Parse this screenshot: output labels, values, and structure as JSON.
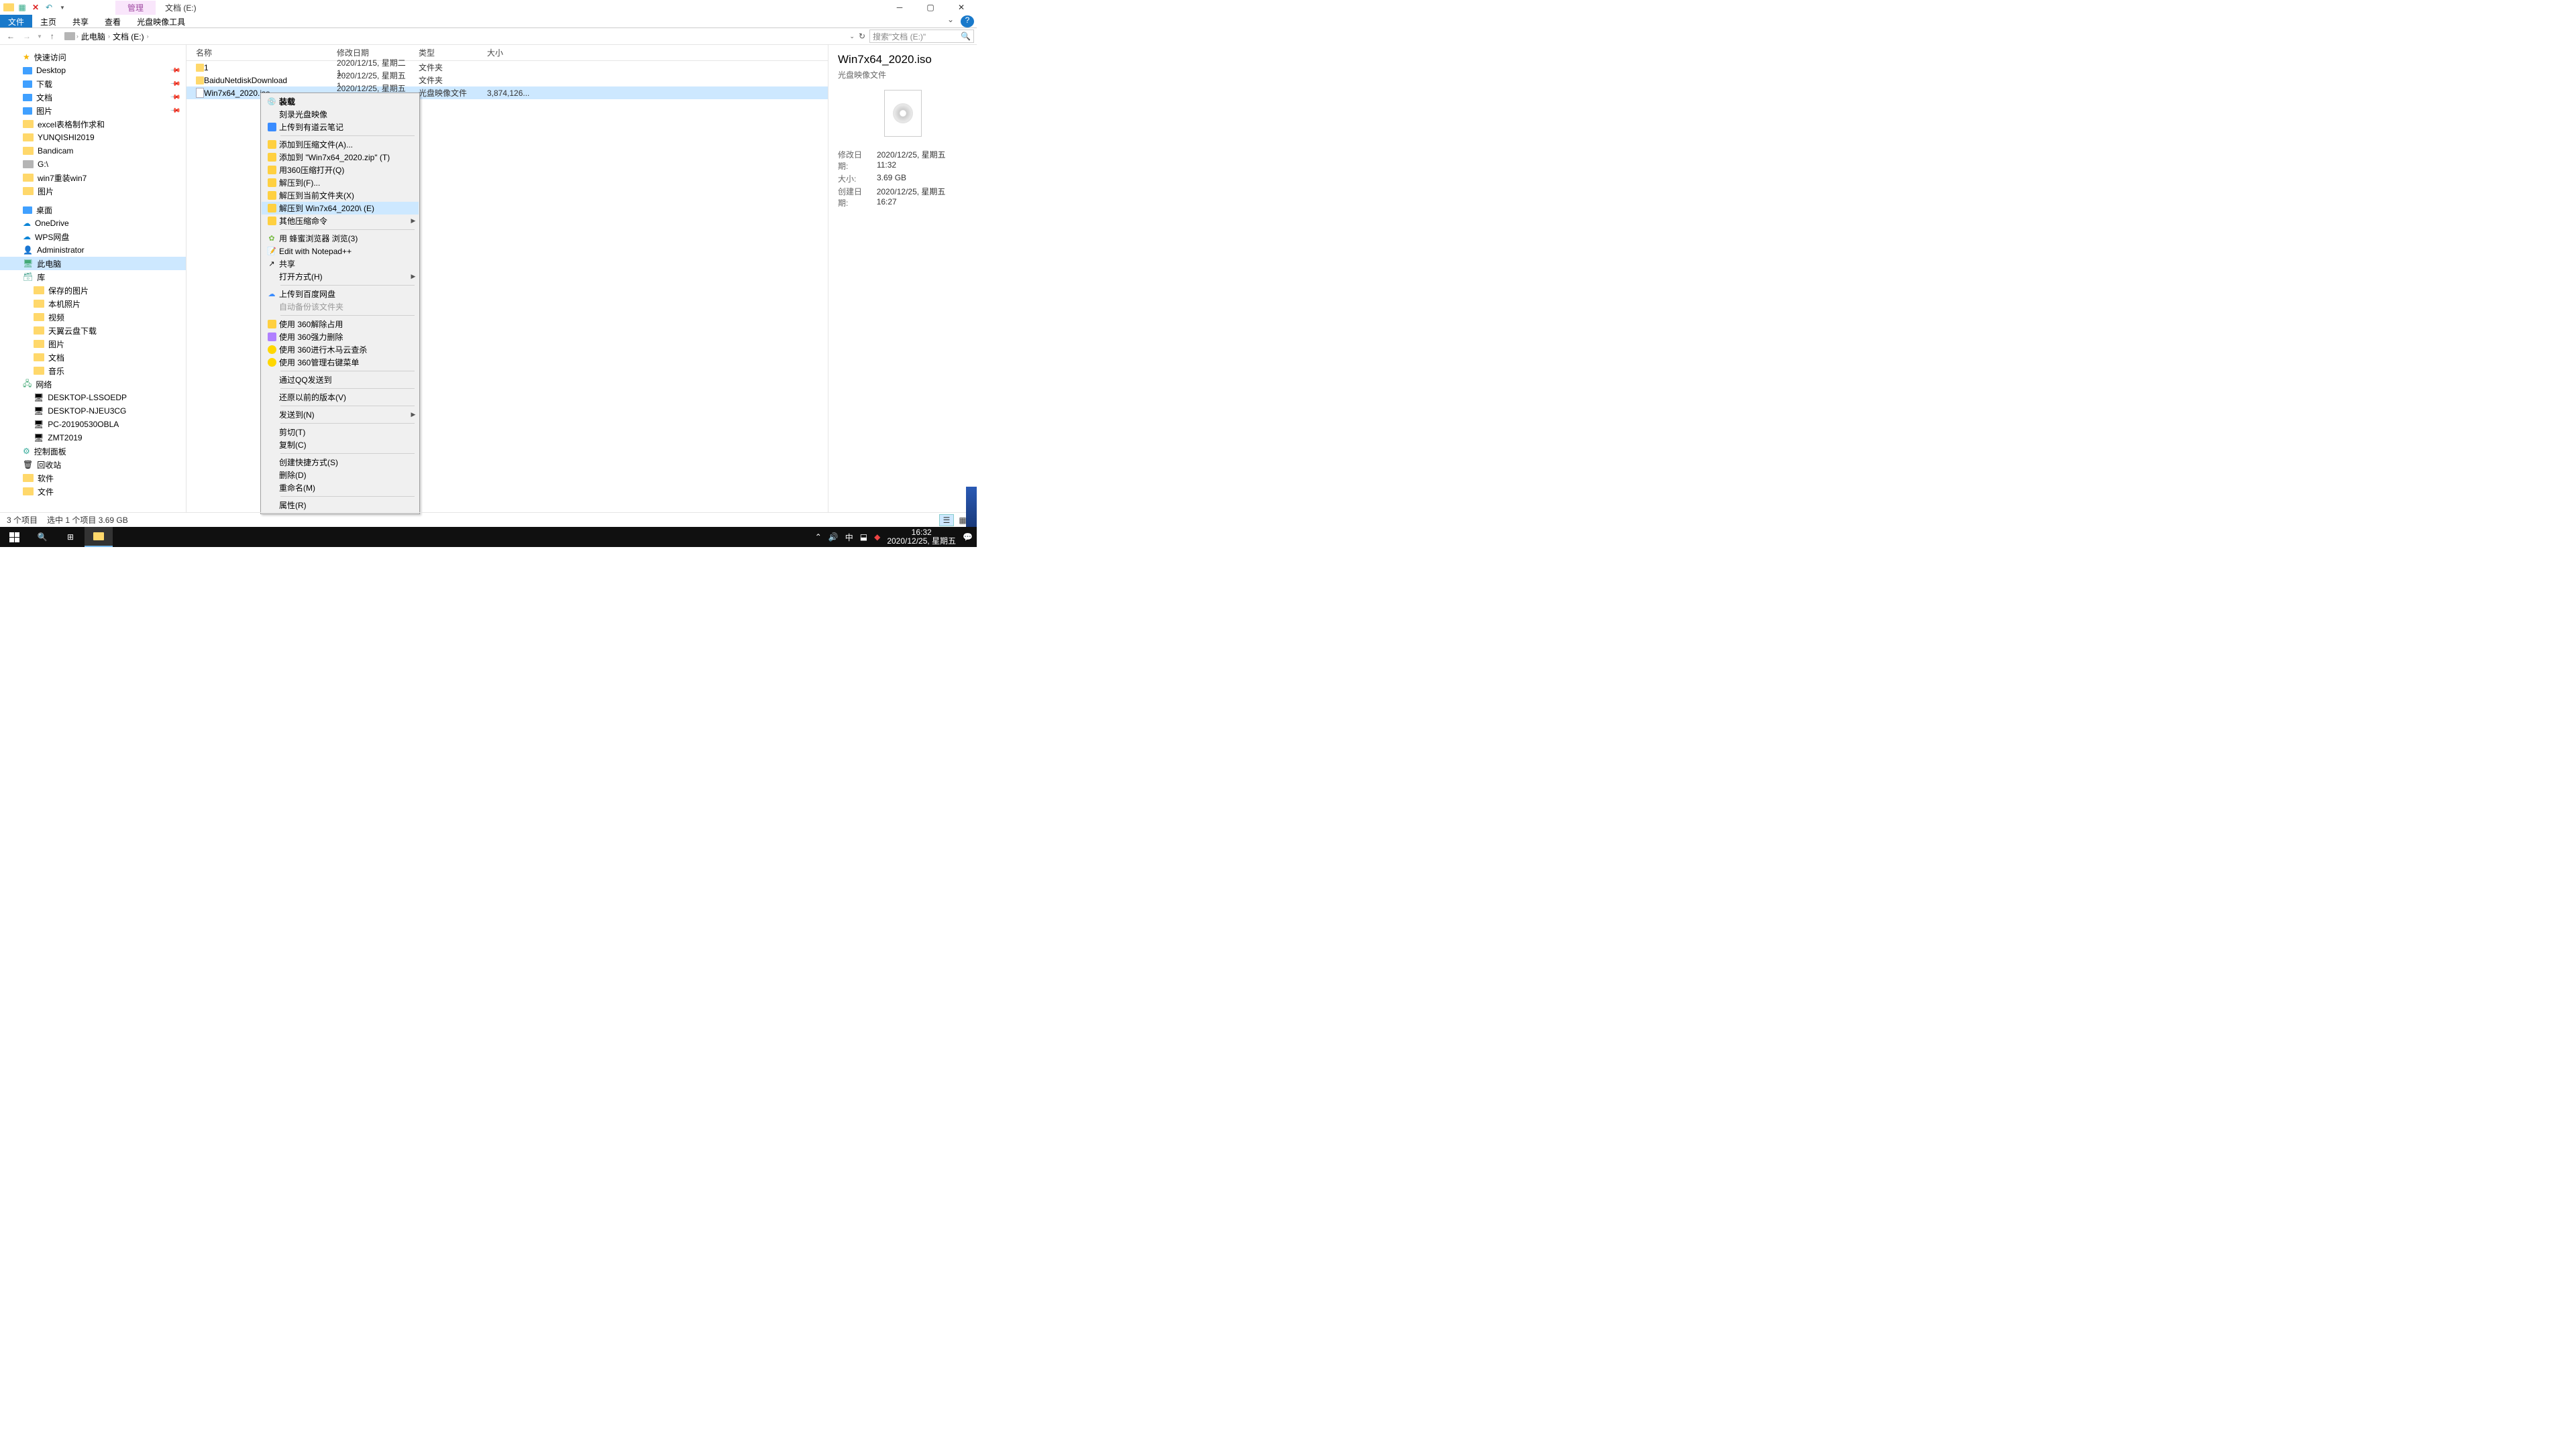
{
  "titlebar": {
    "context_tab": "管理",
    "location_tab": "文档 (E:)"
  },
  "ribbon": {
    "file": "文件",
    "home": "主页",
    "share": "共享",
    "view": "查看",
    "tools": "光盘映像工具"
  },
  "address": {
    "root": "此电脑",
    "crumb": "文档 (E:)",
    "search_placeholder": "搜索\"文档 (E:)\""
  },
  "nav": {
    "quick": "快速访问",
    "items1": [
      "Desktop",
      "下载",
      "文档",
      "图片",
      "excel表格制作求和",
      "YUNQISHI2019",
      "Bandicam",
      "G:\\",
      "win7重装win7",
      "图片"
    ],
    "desktop": "桌面",
    "items2": [
      "OneDrive",
      "WPS网盘",
      "Administrator",
      "此电脑",
      "库"
    ],
    "lib": [
      "保存的图片",
      "本机照片",
      "视频",
      "天翼云盘下载",
      "图片",
      "文档",
      "音乐"
    ],
    "network": "网络",
    "net_items": [
      "DESKTOP-LSSOEDP",
      "DESKTOP-NJEU3CG",
      "PC-20190530OBLA",
      "ZMT2019"
    ],
    "cp": "控制面板",
    "rb": "回收站",
    "sw": "软件",
    "wj": "文件"
  },
  "cols": {
    "name": "名称",
    "date": "修改日期",
    "type": "类型",
    "size": "大小"
  },
  "rows": [
    {
      "name": "1",
      "date": "2020/12/15, 星期二 1...",
      "type": "文件夹",
      "size": ""
    },
    {
      "name": "BaiduNetdiskDownload",
      "date": "2020/12/25, 星期五 1...",
      "type": "文件夹",
      "size": ""
    },
    {
      "name": "Win7x64_2020.iso",
      "date": "2020/12/25, 星期五 1...",
      "type": "光盘映像文件",
      "size": "3,874,126..."
    }
  ],
  "preview": {
    "title": "Win7x64_2020.iso",
    "sub": "光盘映像文件",
    "k1": "修改日期:",
    "v1": "2020/12/25, 星期五 11:32",
    "k2": "大小:",
    "v2": "3.69 GB",
    "k3": "创建日期:",
    "v3": "2020/12/25, 星期五 16:27"
  },
  "ctx": {
    "mount": "装载",
    "burn": "刻录光盘映像",
    "youdao": "上传到有道云笔记",
    "addarchive": "添加到压缩文件(A)...",
    "addzip": "添加到 \"Win7x64_2020.zip\" (T)",
    "open360": "用360压缩打开(Q)",
    "extractf": "解压到(F)...",
    "extractcur": "解压到当前文件夹(X)",
    "extractto": "解压到 Win7x64_2020\\ (E)",
    "othercomp": "其他压缩命令",
    "browse": "用 蜂蜜浏览器 浏览(3)",
    "npp": "Edit with Notepad++",
    "share": "共享",
    "openwith": "打开方式(H)",
    "baidu": "上传到百度网盘",
    "autobk": "自动备份该文件夹",
    "unlock360": "使用 360解除占用",
    "force360": "使用 360强力删除",
    "scan360": "使用 360进行木马云查杀",
    "menu360": "使用 360管理右键菜单",
    "qq": "通过QQ发送到",
    "restore": "还原以前的版本(V)",
    "sendto": "发送到(N)",
    "cut": "剪切(T)",
    "copy": "复制(C)",
    "shortcut": "创建快捷方式(S)",
    "delete": "删除(D)",
    "rename": "重命名(M)",
    "props": "属性(R)"
  },
  "status": {
    "count": "3 个项目",
    "sel": "选中 1 个项目  3.69 GB"
  },
  "taskbar": {
    "ime": "中",
    "time": "16:32",
    "date": "2020/12/25, 星期五"
  }
}
